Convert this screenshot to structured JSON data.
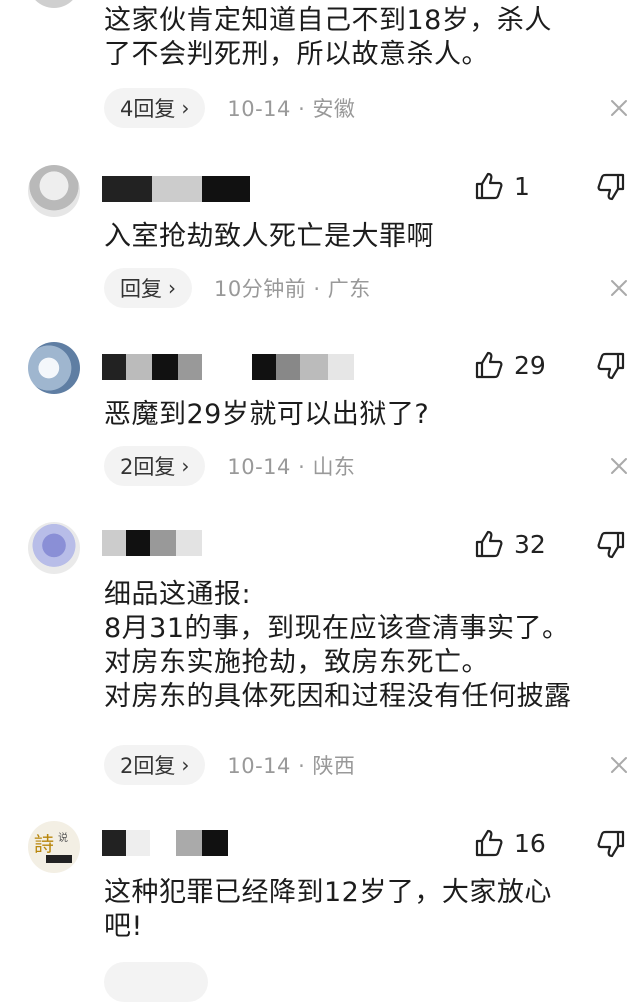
{
  "comments": [
    {
      "text_lines": [
        "这家伙肯定知道自己不到18岁，杀人",
        "了不会判死刑，所以故意杀人。"
      ],
      "reply_label": "4回复",
      "date": "10-14",
      "location": "安徽"
    },
    {
      "likes": "1",
      "text_lines": [
        "入室抢劫致人死亡是大罪啊"
      ],
      "reply_label": "回复",
      "date": "10分钟前",
      "location": "广东"
    },
    {
      "likes": "29",
      "text_lines": [
        "恶魔到29岁就可以出狱了?"
      ],
      "reply_label": "2回复",
      "date": "10-14",
      "location": "山东"
    },
    {
      "likes": "32",
      "text_lines": [
        "细品这通报:",
        "8月31的事，到现在应该查清事实了。",
        "对房东实施抢劫，致房东死亡。",
        "对房东的具体死因和过程没有任何披露"
      ],
      "reply_label": "2回复",
      "date": "10-14",
      "location": "陕西"
    },
    {
      "likes": "16",
      "text_lines": [
        "这种犯罪已经降到12岁了，大家放心",
        "吧!"
      ]
    }
  ],
  "separator": " · ",
  "icons": {
    "like": "thumb-up-icon",
    "dislike": "thumb-down-icon",
    "close": "close-icon",
    "chevron": "chevron-right-icon"
  }
}
